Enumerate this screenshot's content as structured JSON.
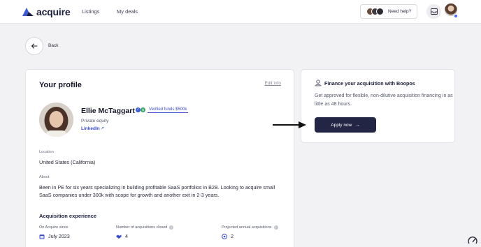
{
  "nav": {
    "logo_text": "acquire",
    "links": [
      "Listings",
      "My deals"
    ],
    "help_label": "Need help?",
    "avatar_colors": [
      "#6b4a3a",
      "#3e3a40",
      "#2c2a33"
    ]
  },
  "back": {
    "label": "Back"
  },
  "profile": {
    "title": "Your profile",
    "edit_label": "Edit info",
    "name": "Ellie McTaggart",
    "verified_funds": "Verified funds $500k",
    "role": "Private equity",
    "linkedin": "LinkedIn",
    "location_label": "Location",
    "location_value": "United States (California)",
    "about_label": "About",
    "about_value": "Been in PE for six years specializing in building profitable SaaS portfolios in B2B. Looking to acquire small SaaS companies under 300k with scope for growth and another exit in 2-3 years.",
    "experience_title": "Acquisition experience",
    "stats": [
      {
        "label": "On Acquire since",
        "value": "July 2023",
        "icon": "calendar-icon"
      },
      {
        "label": "Number of acquisitions closed",
        "value": "4",
        "icon": "handshake-icon"
      },
      {
        "label": "Projected annual acquisitions",
        "value": "2",
        "icon": "target-icon"
      }
    ]
  },
  "finance": {
    "title": "Finance your acquisition with Boopos",
    "description": "Get approved for flexible, non-dilutive acquisition financing in as little as 48 hours.",
    "apply_label": "Apply now",
    "apply_arrow": "→"
  },
  "colors": {
    "accent": "#3a4bd0",
    "button_dark": "#232545",
    "background": "#f2f2f4"
  }
}
